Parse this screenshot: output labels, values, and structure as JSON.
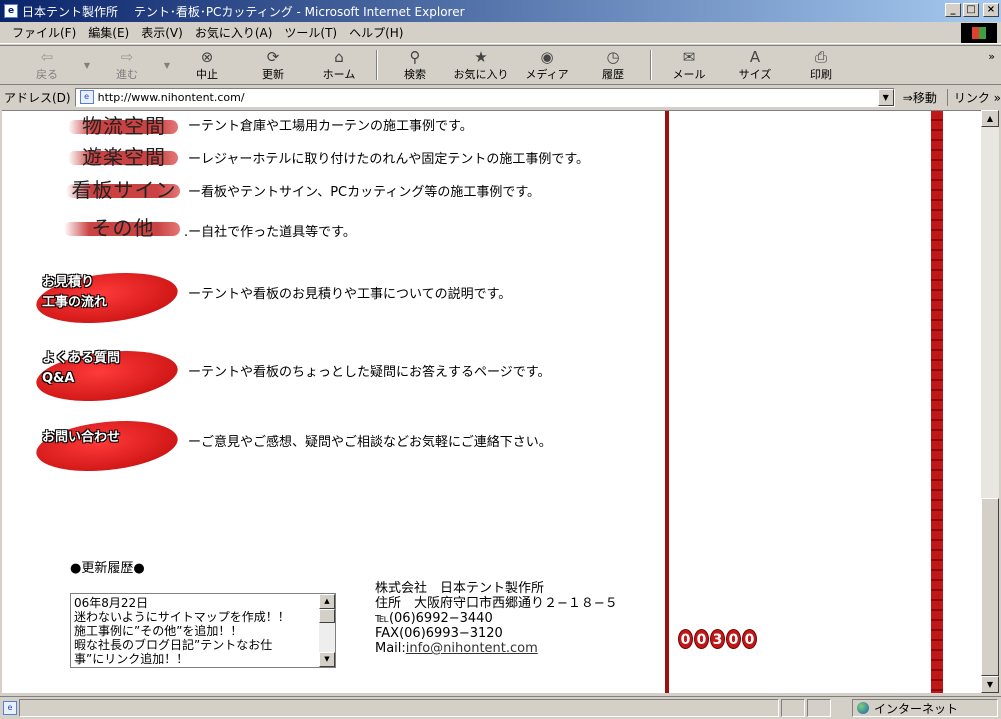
{
  "window": {
    "title": "日本テント製作所　 テント･看板･PCカッティング - Microsoft Internet Explorer",
    "buttons": {
      "minimize": "_",
      "maximize": "□",
      "close": "×"
    }
  },
  "menu": [
    "ファイル(F)",
    "編集(E)",
    "表示(V)",
    "お気に入り(A)",
    "ツール(T)",
    "ヘルプ(H)"
  ],
  "toolbar": {
    "back": "戻る",
    "forward": "進む",
    "stop": "中止",
    "refresh": "更新",
    "home": "ホーム",
    "search": "検索",
    "favorites": "お気に入り",
    "media": "メディア",
    "history": "履歴",
    "mail": "メール",
    "size": "サイズ",
    "print": "印刷",
    "more": "»"
  },
  "address": {
    "label": "アドレス(D)",
    "url": "http://www.nihontent.com/",
    "go": "移動",
    "links": "リンク »"
  },
  "categories": [
    {
      "label": "物流空間",
      "desc_html": "ーテント倉庫や工場用カーテンの施工事例です。"
    },
    {
      "label": "遊楽空間",
      "desc_html": "ーレジャーホテルに取り付けたのれんや固定テントの施工事例です。"
    },
    {
      "label": "看板サイン",
      "desc_html": "ー看板やテントサイン、PCカッティング等の施工事例です。"
    },
    {
      "label": "その他",
      "desc_html": ".ー自社で作った道具等です。"
    }
  ],
  "sections": [
    {
      "line1": "お見積り",
      "line2": "工事の流れ",
      "desc": "ーテントや看板のお見積りや工事についての説明です。"
    },
    {
      "line1": "よくある質問",
      "line2": "Q&A",
      "desc": "ーテントや看板のちょっとした疑問にお答えするページです。"
    },
    {
      "line1": "お問い合わせ",
      "line2": "",
      "desc": "ーご意見やご感想、疑問やご相談などお気軽にご連絡下さい。"
    }
  ],
  "history": {
    "title": "●更新履歴●",
    "lines": [
      "06年8月22日",
      "迷わないようにサイトマップを作成！！",
      "施工事例に”その他”を追加！！",
      "暇な社長のブログ日記”テントなお仕",
      "事”にリンク追加！！"
    ]
  },
  "company": {
    "name": "株式会社　日本テント製作所",
    "address": "住所　大阪府守口市西郷通り２−１８−５",
    "tel": "℡(06)6992−3440",
    "fax": "FAX(06)6993−3120",
    "mail_label": "Mail:",
    "mail": "info@nihontent.com"
  },
  "counter": [
    "0",
    "0",
    "3",
    "0",
    "0"
  ],
  "status": {
    "zone": "インターネット"
  },
  "colors": {
    "accent_red": "#c01818",
    "dark_red": "#9c1010"
  }
}
